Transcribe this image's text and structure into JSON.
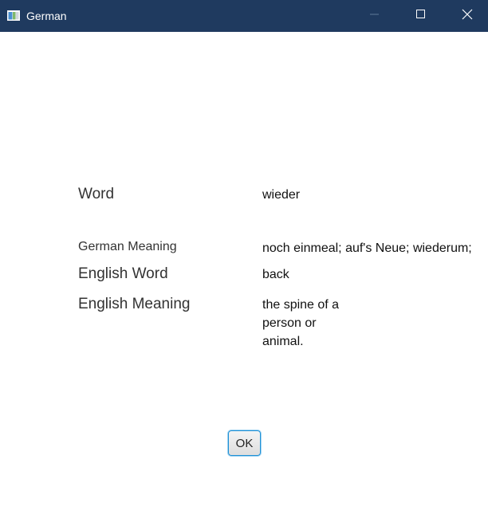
{
  "window": {
    "title": "German",
    "icons": {
      "app": "app-window-icon",
      "minimize": "minimize-icon",
      "maximize": "maximize-icon",
      "close": "close-icon"
    },
    "titlebar_color": "#1f3a5f"
  },
  "form": {
    "word_label": "Word",
    "word_value": "wieder",
    "german_meaning_label": "German Meaning",
    "german_meaning_value": "noch einmeal; auf's Neue; wiederum;",
    "english_word_label": "English Word",
    "english_word_value": "back",
    "english_meaning_label": "English Meaning",
    "english_meaning_value": "the spine of a person or animal."
  },
  "actions": {
    "ok_label": "OK"
  }
}
